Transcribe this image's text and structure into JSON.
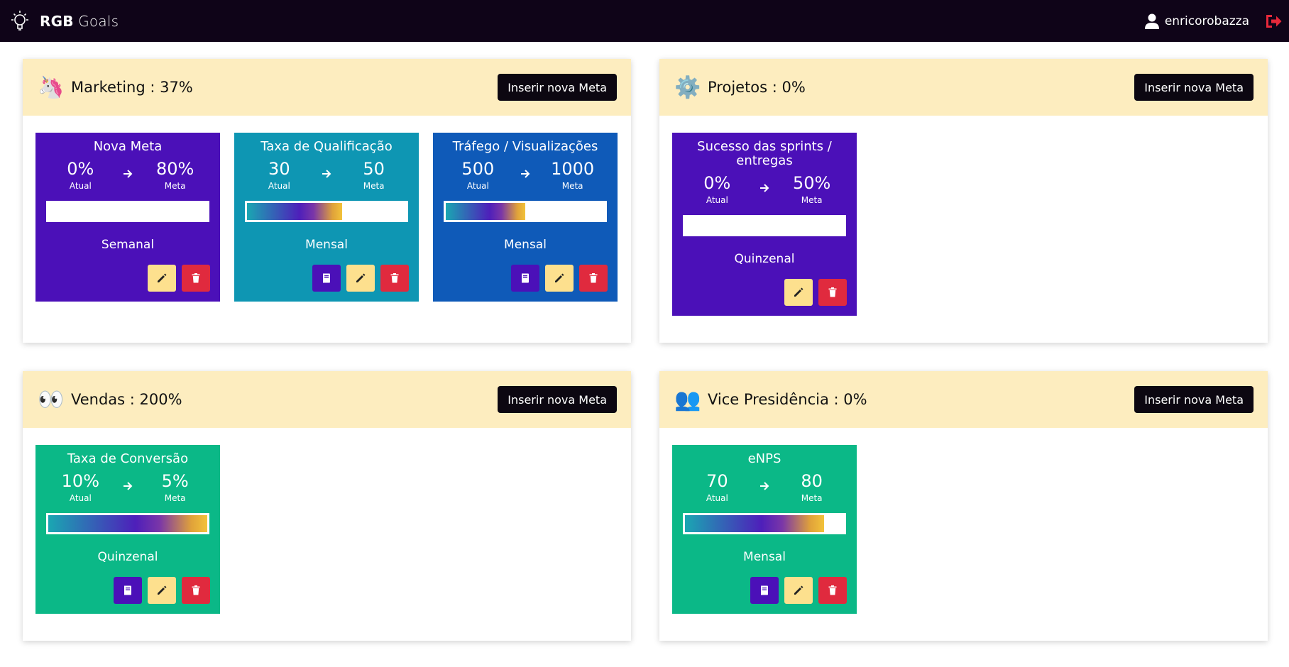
{
  "navbar": {
    "brand_bold": "RGB",
    "brand_light": " Goals",
    "username": "enricorobazza",
    "logo_icon": "lightbulb-icon",
    "user_icon": "user-icon",
    "logout_icon": "logout-icon"
  },
  "colors": {
    "navbar": "#0f0418",
    "panel_header": "#fdedbf",
    "purple": "#4b10b8",
    "teal": "#0e96b3",
    "blue": "#0f5ab8",
    "green": "#0bb887",
    "edit": "#fde08e",
    "delete": "#e02a3e"
  },
  "panels": [
    {
      "emoji": "🦄",
      "title": "Marketing : 37%",
      "button": "Inserir nova Meta",
      "goals": [
        {
          "title": "Nova Meta",
          "current": "0%",
          "current_label": "Atual",
          "target": "80%",
          "target_label": "Meta",
          "progress": 0,
          "period": "Semanal",
          "color": "#4b10b8",
          "has_book": false
        },
        {
          "title": "Taxa de Qualificação",
          "current": "30",
          "current_label": "Atual",
          "target": "50",
          "target_label": "Meta",
          "progress": 0.6,
          "period": "Mensal",
          "color": "#0e96b3",
          "has_book": true
        },
        {
          "title": "Tráfego / Visualizações",
          "current": "500",
          "current_label": "Atual",
          "target": "1000",
          "target_label": "Meta",
          "progress": 0.5,
          "period": "Mensal",
          "color": "#0f5ab8",
          "has_book": true
        }
      ]
    },
    {
      "emoji": "⚙️",
      "title": "Projetos : 0%",
      "button": "Inserir nova Meta",
      "goals": [
        {
          "title": "Sucesso das sprints / entregas",
          "current": "0%",
          "current_label": "Atual",
          "target": "50%",
          "target_label": "Meta",
          "progress": 0,
          "period": "Quinzenal",
          "color": "#4b10b8",
          "has_book": false
        }
      ]
    },
    {
      "emoji": "👀",
      "title": "Vendas : 200%",
      "button": "Inserir nova Meta",
      "goals": [
        {
          "title": "Taxa de Conversão",
          "current": "10%",
          "current_label": "Atual",
          "target": "5%",
          "target_label": "Meta",
          "progress": 1,
          "period": "Quinzenal",
          "color": "#0bb887",
          "has_book": true
        }
      ]
    },
    {
      "emoji": "👥",
      "title": "Vice Presidência : 0%",
      "button": "Inserir nova Meta",
      "goals": [
        {
          "title": "eNPS",
          "current": "70",
          "current_label": "Atual",
          "target": "80",
          "target_label": "Meta",
          "progress": 0.875,
          "period": "Mensal",
          "color": "#0bb887",
          "has_book": true
        }
      ]
    }
  ]
}
